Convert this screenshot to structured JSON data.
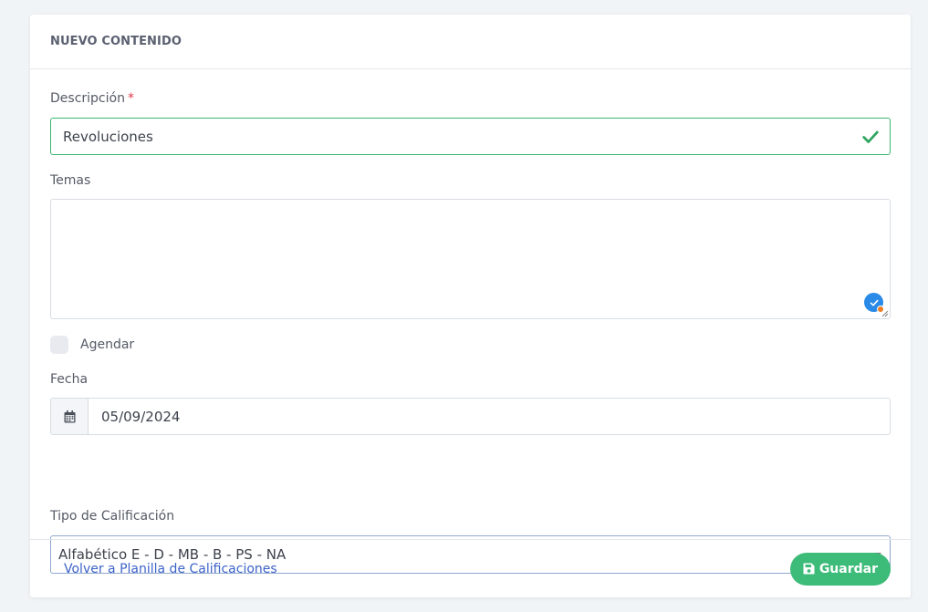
{
  "card": {
    "title": "NUEVO CONTENIDO"
  },
  "form": {
    "descripcion": {
      "label": "Descripción",
      "required_mark": "*",
      "value": "Revoluciones"
    },
    "temas": {
      "label": "Temas",
      "value": ""
    },
    "agendar": {
      "label": "Agendar",
      "checked": false
    },
    "fecha": {
      "label": "Fecha",
      "value": "05/09/2024",
      "icon": "calendar-icon"
    },
    "tipo_calificacion": {
      "label": "Tipo de Calificación",
      "selected": "Alfabético E - D - MB - B - PS - NA"
    }
  },
  "footer": {
    "back_link": "Volver a Planilla de Calificaciones",
    "save_label": "Guardar",
    "save_icon": "floppy-disk-icon"
  },
  "colors": {
    "valid": "#3cb871",
    "link": "#3d63c8",
    "save_button": "#3dbb79",
    "required": "#e0394a"
  }
}
